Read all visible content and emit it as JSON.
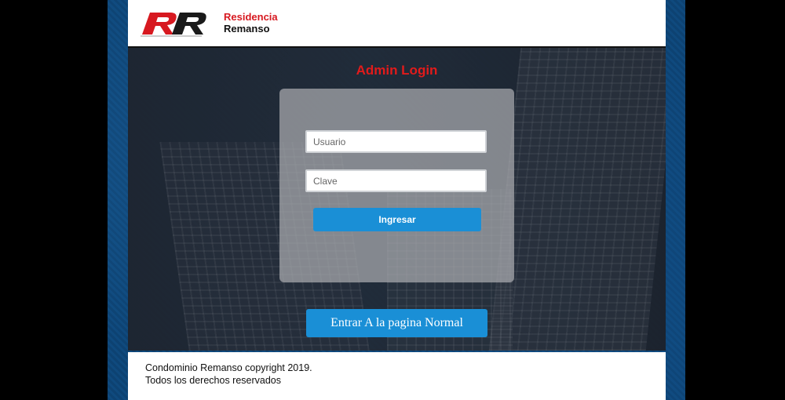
{
  "header": {
    "logo_word1": "Residencia",
    "logo_word2": "Remanso"
  },
  "login": {
    "title": "Admin Login",
    "username_placeholder": "Usuario",
    "password_placeholder": "Clave",
    "submit_label": "Ingresar"
  },
  "normal_page_button": "Entrar A la pagina Normal",
  "footer": {
    "line1": "Condominio Remanso copyright 2019.",
    "line2": "Todos los derechos reservados"
  },
  "colors": {
    "accent_red": "#e21b1b",
    "button_blue": "#1a8fd6",
    "hero_dark": "#1f2530"
  }
}
